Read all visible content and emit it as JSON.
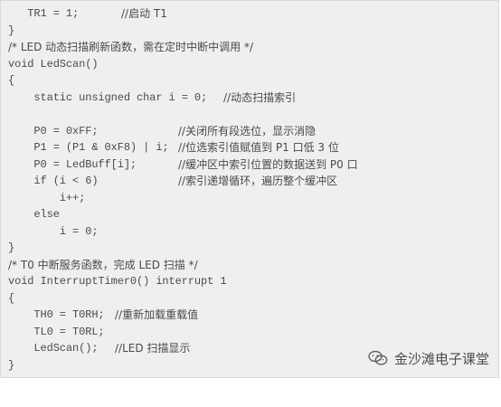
{
  "watermark": {
    "icon": "wechat-icon",
    "text": "金沙滩电子课堂"
  },
  "code_lines": [
    {
      "code": "   TR1 = 1;",
      "comment": "//启动 T1"
    },
    {
      "code": "}",
      "comment": ""
    },
    {
      "code": "",
      "comment": "/* LED 动态扫描刷新函数，需在定时中断中调用 */"
    },
    {
      "code": "void LedScan()",
      "comment": ""
    },
    {
      "code": "{",
      "comment": ""
    },
    {
      "code": "    static unsigned char i = 0;",
      "comment": "//动态扫描索引"
    },
    {
      "code": "",
      "comment": ""
    },
    {
      "code": "    P0 = 0xFF;",
      "comment": "//关闭所有段选位，显示消隐"
    },
    {
      "code": "    P1 = (P1 & 0xF8) | i;",
      "comment": "//位选索引值赋值到 P1 口低 3 位"
    },
    {
      "code": "    P0 = LedBuff[i];",
      "comment": "//缓冲区中索引位置的数据送到 P0 口"
    },
    {
      "code": "    if (i < 6)",
      "comment": "//索引递增循环，遍历整个缓冲区"
    },
    {
      "code": "        i++;",
      "comment": ""
    },
    {
      "code": "    else",
      "comment": ""
    },
    {
      "code": "        i = 0;",
      "comment": ""
    },
    {
      "code": "}",
      "comment": ""
    },
    {
      "code": "",
      "comment": "/* T0 中断服务函数，完成 LED 扫描 */"
    },
    {
      "code": "void InterruptTimer0() interrupt 1",
      "comment": ""
    },
    {
      "code": "{",
      "comment": ""
    },
    {
      "code": "    TH0 = T0RH;",
      "comment": "//重新加载重载值"
    },
    {
      "code": "    TL0 = T0RL;",
      "comment": ""
    },
    {
      "code": "    LedScan();",
      "comment": "//LED 扫描显示"
    },
    {
      "code": "}",
      "comment": ""
    }
  ]
}
